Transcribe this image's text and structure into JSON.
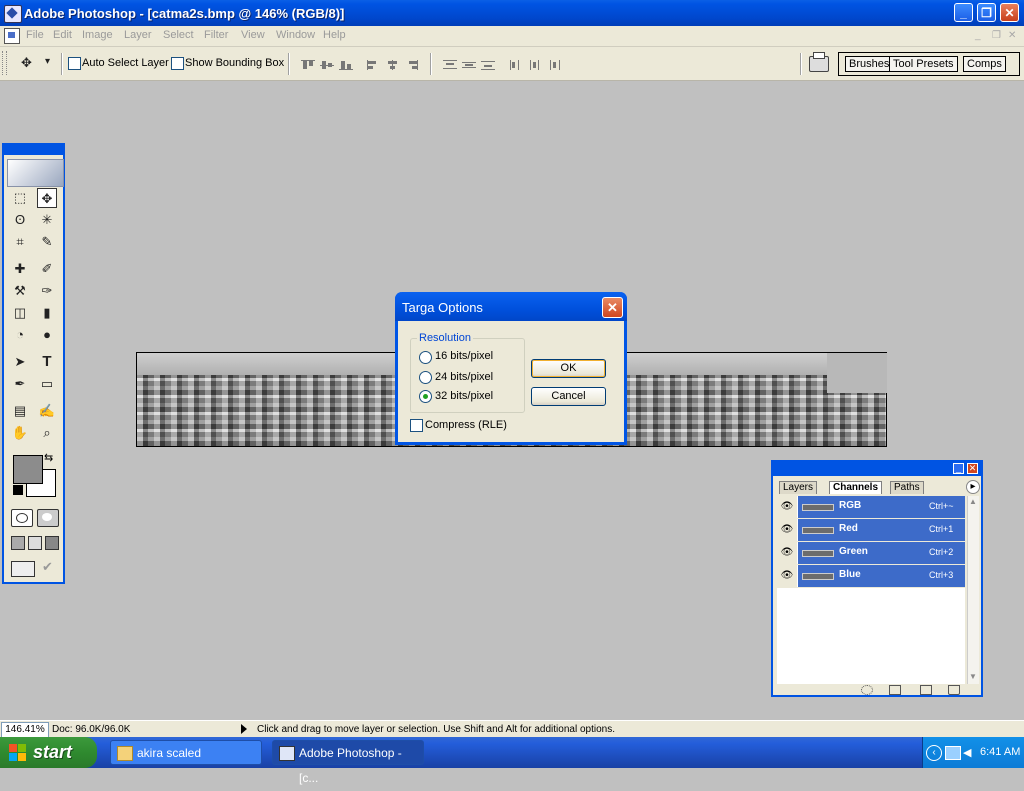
{
  "window": {
    "title": "Adobe Photoshop - [catma2s.bmp @ 146% (RGB/8)]",
    "minimize_glyph": "_",
    "restore_glyph": "❐",
    "close_glyph": "✕"
  },
  "menubar": {
    "items": [
      "File",
      "Edit",
      "Image",
      "Layer",
      "Select",
      "Filter",
      "View",
      "Window",
      "Help"
    ]
  },
  "options": {
    "auto_select_layer": "Auto Select Layer",
    "show_bounding_box": "Show Bounding Box",
    "tool_glyph": "✥",
    "dropdown_glyph": "▾"
  },
  "palette_well": {
    "tabs": [
      "Brushes",
      "Tool Presets",
      "Comps"
    ]
  },
  "toolbox": {
    "tools": [
      "⬚",
      "✥",
      "ʘ",
      "✳",
      "⌗",
      "✎",
      "✚",
      "✐",
      "⚒",
      "✑",
      "◫",
      "▮",
      "◔",
      "●",
      "➤",
      "T",
      "✒",
      "▭",
      "▤",
      "✍",
      "✋",
      "⌕"
    ],
    "swap_glyph": "⇆"
  },
  "dialog": {
    "title": "Targa Options",
    "close_glyph": "✕",
    "group_label": "Resolution",
    "options": [
      "16 bits/pixel",
      "24 bits/pixel",
      "32 bits/pixel"
    ],
    "selected_index": 2,
    "compress_label": "Compress (RLE)",
    "compress_checked": false,
    "ok_label": "OK",
    "cancel_label": "Cancel"
  },
  "channels_palette": {
    "tabs": [
      "Layers",
      "Channels",
      "Paths"
    ],
    "active_tab": "Channels",
    "eye_glyph": "👁",
    "menu_glyph": "▸",
    "channels": [
      {
        "name": "RGB",
        "shortcut": "Ctrl+~"
      },
      {
        "name": "Red",
        "shortcut": "Ctrl+1"
      },
      {
        "name": "Green",
        "shortcut": "Ctrl+2"
      },
      {
        "name": "Blue",
        "shortcut": "Ctrl+3"
      }
    ]
  },
  "statusbar": {
    "zoom": "146.41%",
    "doc_size": "Doc: 96.0K/96.0K",
    "hint": "Click and drag to move layer or selection.  Use Shift and Alt for additional options."
  },
  "taskbar": {
    "start_label": "start",
    "tasks": [
      {
        "label": "akira scaled",
        "icon": "folder-icon"
      },
      {
        "label": "Adobe Photoshop - [c...",
        "icon": "photoshop-icon"
      }
    ],
    "tray_chevron": "‹",
    "volume_glyph": "◀",
    "clock": "6:41 AM"
  },
  "colors": {
    "xp_blue": "#0054e3",
    "workspace": "#c0c0c0",
    "face": "#ece9d8",
    "start_green": "#2f8a2f",
    "channel_selected": "#3d6bc9",
    "foreground_color": "#8c8c8c",
    "background_color": "#ffffff"
  }
}
